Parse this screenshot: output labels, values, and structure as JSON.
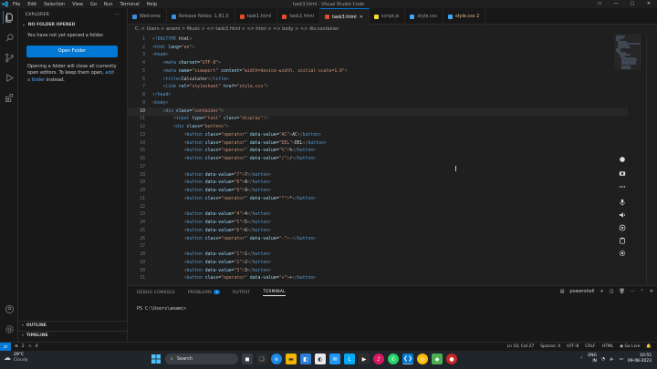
{
  "window": {
    "title": "task3.html - Visual Studio Code",
    "menu": [
      "File",
      "Edit",
      "Selection",
      "View",
      "Go",
      "Run",
      "Terminal",
      "Help"
    ]
  },
  "sidebar": {
    "header": "EXPLORER",
    "section": "NO FOLDER OPENED",
    "no_folder_text": "You have not yet opened a folder.",
    "open_folder_button": "Open Folder",
    "info_text_1": "Opening a folder will close all currently open editors. To keep them open, ",
    "info_link": "add a folder",
    "info_text_2": " instead.",
    "outline": "OUTLINE",
    "timeline": "TIMELINE"
  },
  "tabs": [
    {
      "label": "Welcome",
      "icon_color": "#3c8ee6",
      "active": false
    },
    {
      "label": "Release Notes: 1.81.0",
      "icon_color": "#3c8ee6",
      "active": false
    },
    {
      "label": "task1.html",
      "icon_color": "#e44d26",
      "active": false
    },
    {
      "label": "task2.html",
      "icon_color": "#e44d26",
      "active": false
    },
    {
      "label": "task3.html",
      "icon_color": "#e44d26",
      "active": true
    },
    {
      "label": "script.js",
      "icon_color": "#f1dd35",
      "active": false
    },
    {
      "label": "style.css",
      "icon_color": "#42a5f5",
      "active": false
    },
    {
      "label": "style.css 2",
      "icon_color": "#42a5f5",
      "active": false,
      "modified": true
    }
  ],
  "breadcrumb": "C: > Users > anami > Music > <> task3.html > <> html > <> body > <> div.container",
  "editor": {
    "current_line": 10,
    "lines": [
      {
        "n": "1",
        "text": "<!DOCTYPE html>"
      },
      {
        "n": "2",
        "text": "<html lang=\"en\">"
      },
      {
        "n": "3",
        "text": "<head>"
      },
      {
        "n": "4",
        "text": "    <meta charset=\"UTF-8\">"
      },
      {
        "n": "5",
        "text": "    <meta name=\"viewport\" content=\"width=device-width, initial-scale=1.0\">"
      },
      {
        "n": "6",
        "text": "    <title>Calculator</title>"
      },
      {
        "n": "7",
        "text": "    <link rel=\"stylesheet\" href=\"style.css\">"
      },
      {
        "n": "8",
        "text": "</head>"
      },
      {
        "n": "9",
        "text": "<body>"
      },
      {
        "n": "10",
        "text": "    <div class=\"container\">"
      },
      {
        "n": "11",
        "text": "        <input type=\"text\" class=\"display\"/>"
      },
      {
        "n": "12",
        "text": "        <div class=\"buttons\">"
      },
      {
        "n": "13",
        "text": "            <button class=\"operator\" data-value=\"AC\">AC</button>"
      },
      {
        "n": "14",
        "text": "            <button class=\"operator\" data-value=\"DEL\">DEL</button>"
      },
      {
        "n": "15",
        "text": "            <button class=\"operator\" data-value=\"%\">%</button>"
      },
      {
        "n": "16",
        "text": "            <button class=\"operator\" data-value=\"/\">/</button>"
      },
      {
        "n": "17",
        "text": ""
      },
      {
        "n": "18",
        "text": "            <button data-value=\"7\">7</button>"
      },
      {
        "n": "19",
        "text": "            <button data-value=\"8\">8</button>"
      },
      {
        "n": "20",
        "text": "            <button data-value=\"9\">9</button>"
      },
      {
        "n": "21",
        "text": "            <button class=\"operator\" data-value=\"*\">*</button>"
      },
      {
        "n": "22",
        "text": ""
      },
      {
        "n": "23",
        "text": "            <button data-value=\"4\">4</button>"
      },
      {
        "n": "24",
        "text": "            <button data-value=\"5\">5</button>"
      },
      {
        "n": "25",
        "text": "            <button data-value=\"6\">6</button>"
      },
      {
        "n": "26",
        "text": "            <button class=\"operator\" data-value=\"-\">-</button>"
      },
      {
        "n": "27",
        "text": ""
      },
      {
        "n": "28",
        "text": "            <button data-value=\"1\">1</button>"
      },
      {
        "n": "29",
        "text": "            <button data-value=\"2\">2</button>"
      },
      {
        "n": "30",
        "text": "            <button data-value=\"3\">3</button>"
      },
      {
        "n": "31",
        "text": "            <button class=\"operator\" data-value=\"+\">+</button>"
      }
    ]
  },
  "panel": {
    "tabs": [
      {
        "label": "DEBUG CONSOLE",
        "active": false
      },
      {
        "label": "PROBLEMS",
        "active": false,
        "badge": "2"
      },
      {
        "label": "OUTPUT",
        "active": false
      },
      {
        "label": "TERMINAL",
        "active": true
      }
    ],
    "shell": "powershell",
    "prompt": "PS C:\\Users\\anami>"
  },
  "statusbar": {
    "errors": "2",
    "warnings": "0",
    "position": "Ln 10, Col 27",
    "spaces": "Spaces: 4",
    "encoding": "UTF-8",
    "eol": "CRLF",
    "language": "HTML",
    "go_live": "Go Live"
  },
  "taskbar": {
    "temperature": "29°C",
    "weather": "Cloudy",
    "search": "Search",
    "lang": "ENG",
    "region": "IN",
    "time": "10:55",
    "date": "09-08-2023"
  }
}
